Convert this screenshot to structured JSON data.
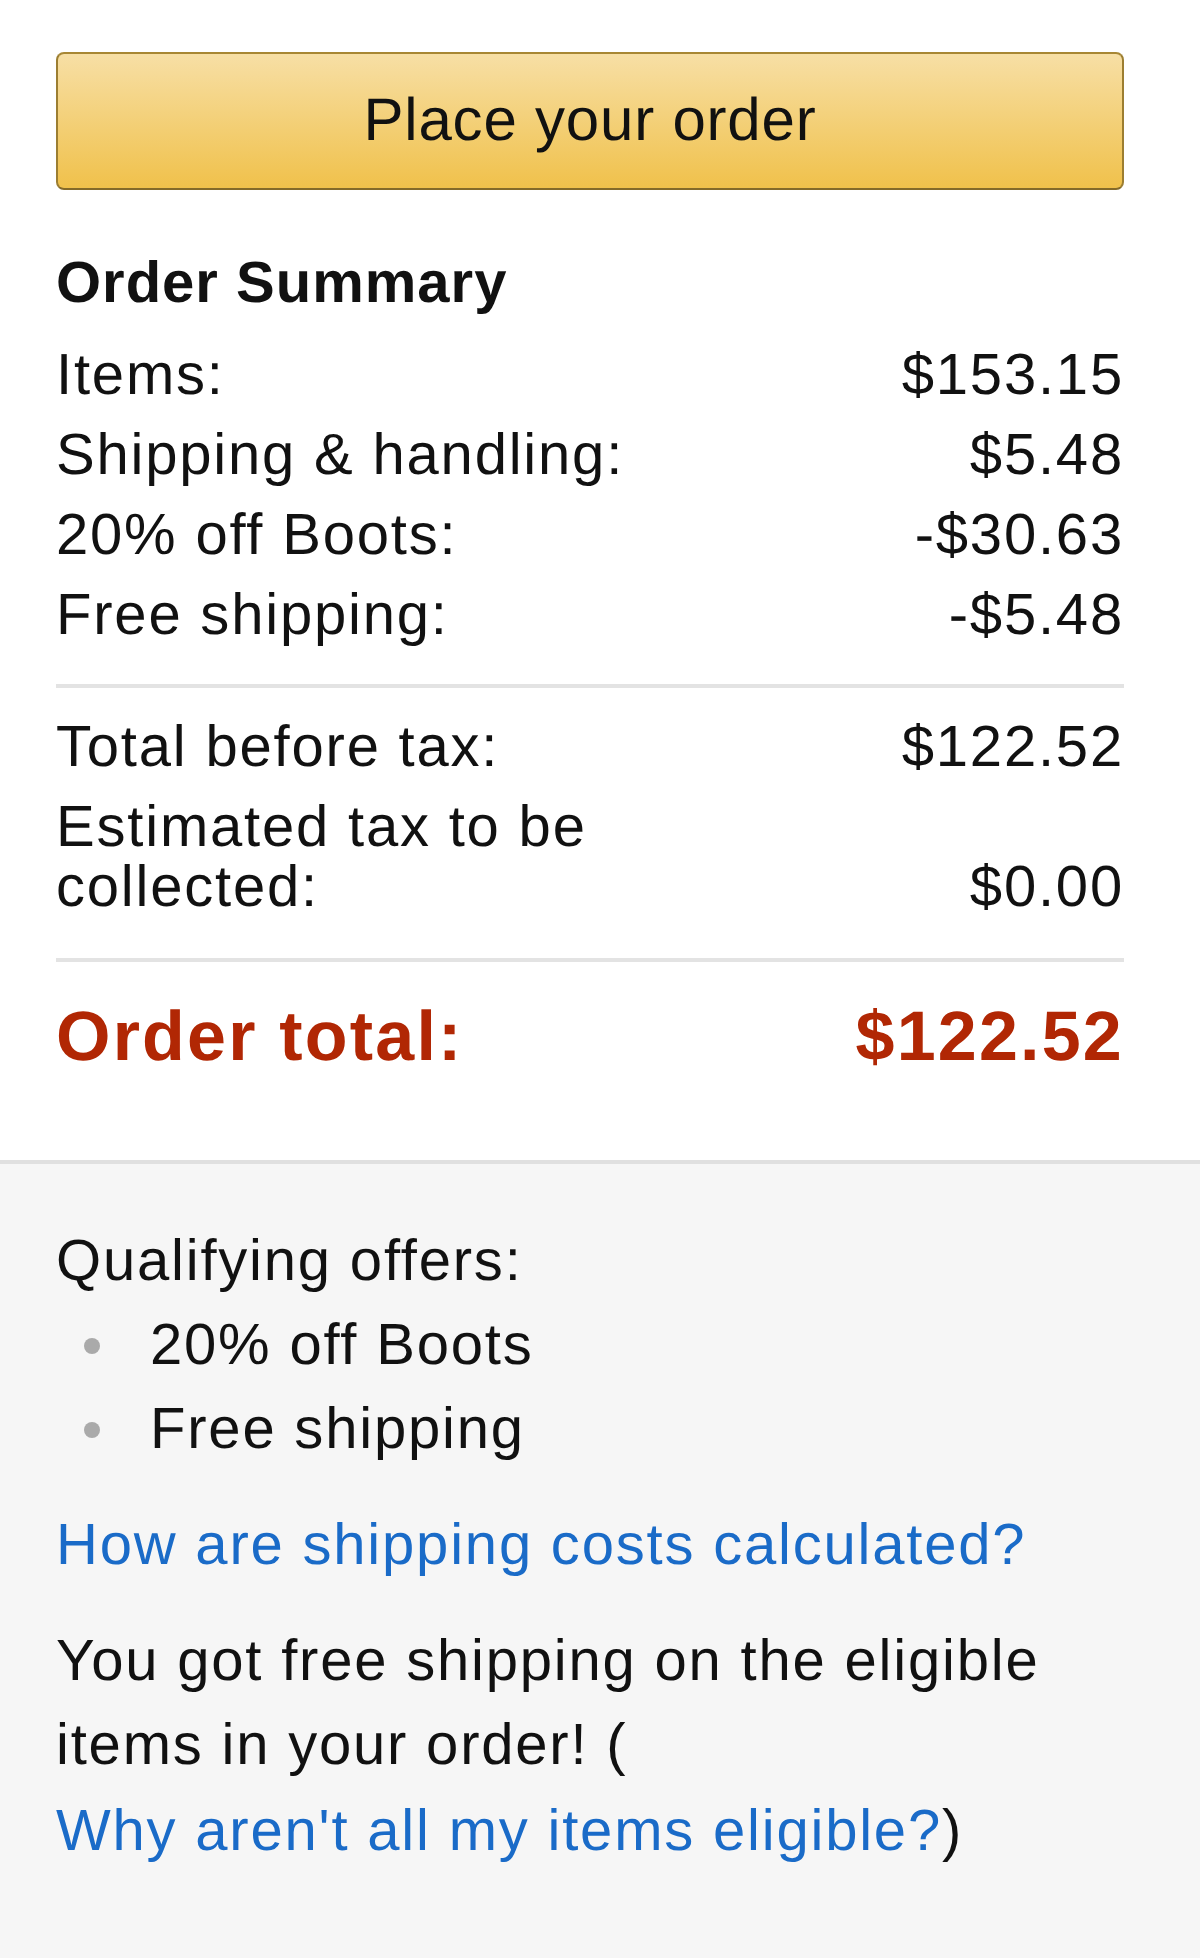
{
  "order_button": {
    "label": "Place your order"
  },
  "summary": {
    "title": "Order Summary",
    "groups": [
      [
        {
          "label": "Items:",
          "amount": "$153.15"
        },
        {
          "label": "Shipping & handling:",
          "amount": "$5.48"
        },
        {
          "label": "20% off Boots:",
          "amount": "-$30.63"
        },
        {
          "label": "Free shipping:",
          "amount": "-$5.48"
        }
      ],
      [
        {
          "label": "Total before tax:",
          "amount": "$122.52"
        },
        {
          "label": "Estimated tax to be collected:",
          "amount": "$0.00"
        }
      ]
    ],
    "total": {
      "label": "Order total:",
      "amount": "$122.52"
    }
  },
  "offers": {
    "title": "Qualifying offers:",
    "items": [
      "20% off Boots",
      "Free shipping"
    ],
    "shipping_link": "How are shipping costs calculated?",
    "note": {
      "text": "You got free shipping on the eligible items in your order! (",
      "link": "Why aren't all my items eligible?",
      "after": ")"
    }
  }
}
